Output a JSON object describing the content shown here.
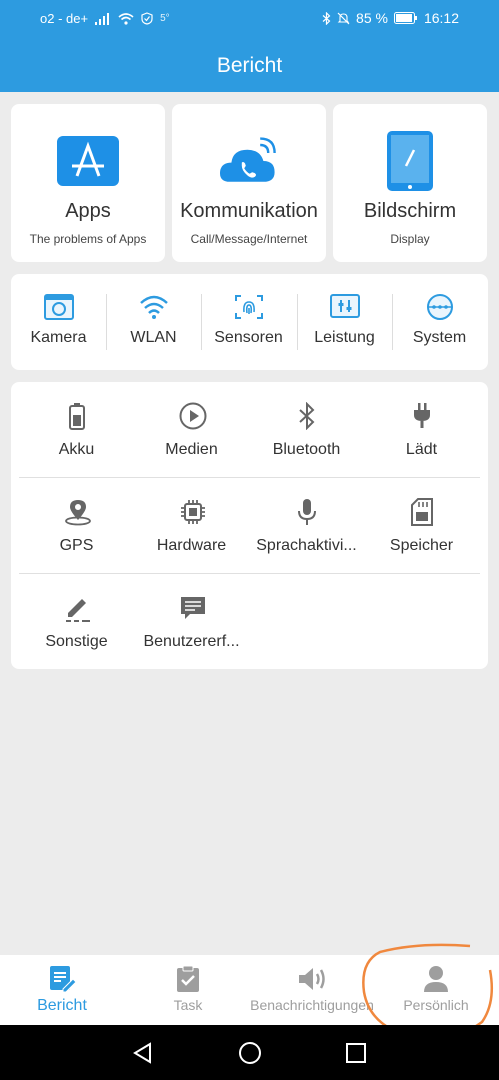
{
  "status_bar": {
    "carrier": "o2 - de+",
    "temp": "5°",
    "battery": "85 %",
    "time": "16:12"
  },
  "header": {
    "title": "Bericht"
  },
  "top_cards": [
    {
      "label": "Apps",
      "sub": "The problems of Apps",
      "icon": "app-store-icon"
    },
    {
      "label": "Kommunikation",
      "sub": "Call/Message/Internet",
      "icon": "phone-cloud-icon"
    },
    {
      "label": "Bildschirm",
      "sub": "Display",
      "icon": "tablet-icon"
    }
  ],
  "row2": [
    {
      "label": "Kamera",
      "icon": "camera-icon"
    },
    {
      "label": "WLAN",
      "icon": "wifi-icon"
    },
    {
      "label": "Sensoren",
      "icon": "fingerprint-icon"
    },
    {
      "label": "Leistung",
      "icon": "performance-icon"
    },
    {
      "label": "System",
      "icon": "system-icon"
    }
  ],
  "grid": [
    {
      "label": "Akku",
      "icon": "battery-icon"
    },
    {
      "label": "Medien",
      "icon": "play-icon"
    },
    {
      "label": "Bluetooth",
      "icon": "bluetooth-icon"
    },
    {
      "label": "Lädt",
      "icon": "plug-icon"
    },
    {
      "label": "GPS",
      "icon": "location-icon"
    },
    {
      "label": "Hardware",
      "icon": "chip-icon"
    },
    {
      "label": "Sprachaktivi...",
      "icon": "microphone-icon"
    },
    {
      "label": "Speicher",
      "icon": "sd-card-icon"
    },
    {
      "label": "Sonstige",
      "icon": "pencil-icon"
    },
    {
      "label": "Benutzererf...",
      "icon": "feedback-icon"
    }
  ],
  "bottom_nav": [
    {
      "label": "Bericht",
      "icon": "report-icon",
      "active": true
    },
    {
      "label": "Task",
      "icon": "clipboard-check-icon",
      "active": false
    },
    {
      "label": "Benachrichtigungen",
      "icon": "speaker-icon",
      "active": false
    },
    {
      "label": "Persönlich",
      "icon": "person-icon",
      "active": false
    }
  ],
  "colors": {
    "accent": "#2d9be0",
    "inactive": "#9e9e9e",
    "annotation": "#f0883e"
  }
}
